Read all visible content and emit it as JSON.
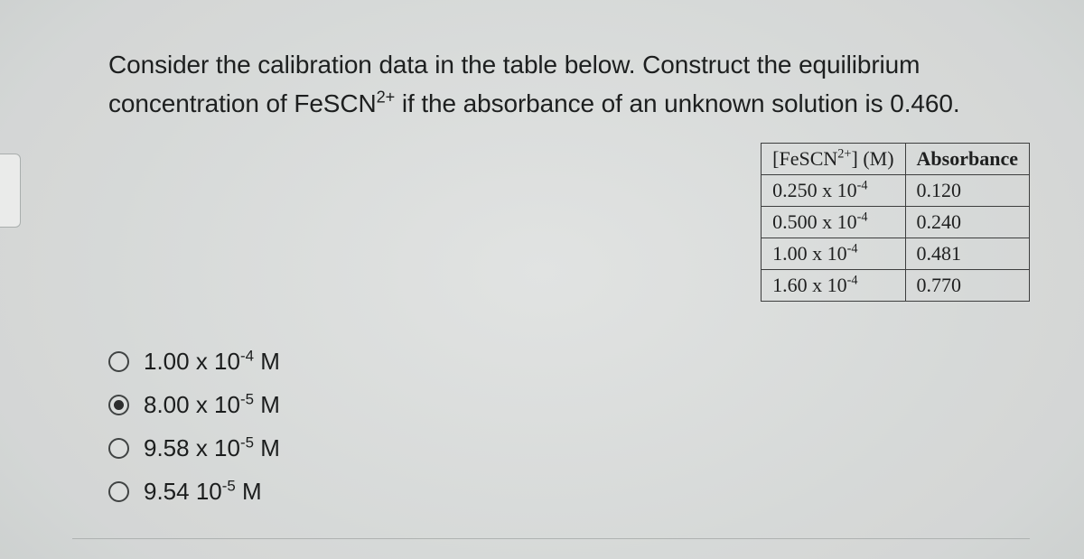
{
  "question": {
    "line1_pre": "Consider the calibration data in the table below. Construct the equilibrium",
    "line2_pre": "concentration of FeSCN",
    "line2_sup": "2+",
    "line2_post": " if the absorbance of an unknown  solution is 0.460."
  },
  "table": {
    "headers": {
      "col1_pre": "[FeSCN",
      "col1_sup": "2+",
      "col1_post": "] (M)",
      "col2": "Absorbance"
    },
    "rows": [
      {
        "conc_pre": "0.250 x 10",
        "conc_sup": "-4",
        "abs": "0.120"
      },
      {
        "conc_pre": "0.500 x 10",
        "conc_sup": "-4",
        "abs": "0.240"
      },
      {
        "conc_pre": "1.00 x 10",
        "conc_sup": "-4",
        "abs": "0.481"
      },
      {
        "conc_pre": "1.60 x 10",
        "conc_sup": "-4",
        "abs": "0.770"
      }
    ]
  },
  "options": [
    {
      "pre": "1.00 x 10",
      "sup": "-4",
      "post": " M",
      "selected": false
    },
    {
      "pre": "8.00 x 10",
      "sup": "-5",
      "post": " M",
      "selected": true
    },
    {
      "pre": "9.58 x 10",
      "sup": "-5",
      "post": " M",
      "selected": false
    },
    {
      "pre": "9.54 10",
      "sup": "-5",
      "post": "  M",
      "selected": false
    }
  ]
}
